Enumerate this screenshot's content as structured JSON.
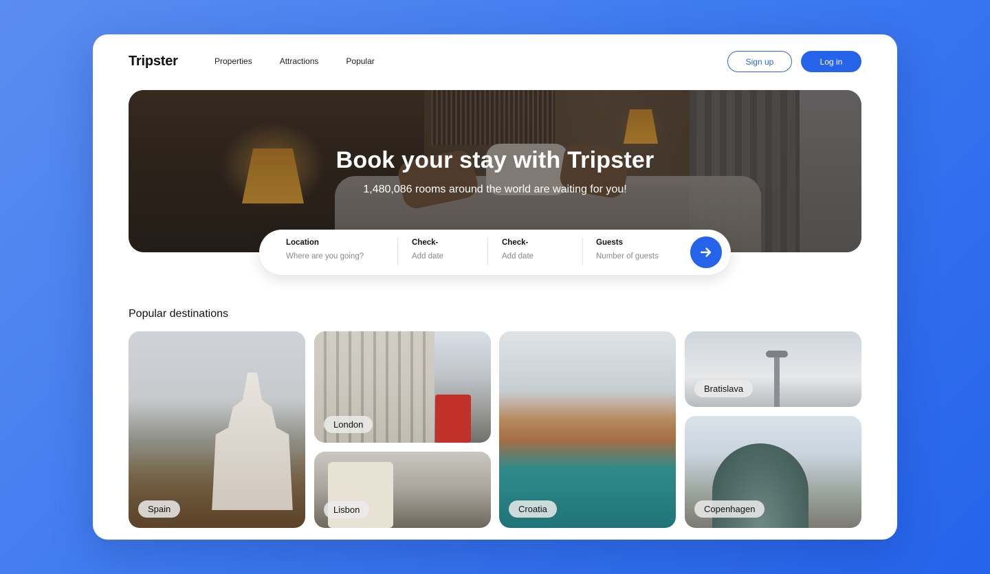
{
  "header": {
    "logo": "Tripster",
    "nav": [
      "Properties",
      "Attractions",
      "Popular"
    ],
    "signup_label": "Sign up",
    "login_label": "Log in"
  },
  "hero": {
    "title": "Book your stay with Tripster",
    "subtitle": "1,480,086 rooms around the world are waiting for you!"
  },
  "search": {
    "fields": [
      {
        "label": "Location",
        "placeholder": "Where are you going?"
      },
      {
        "label": "Check-",
        "placeholder": "Add date"
      },
      {
        "label": "Check-",
        "placeholder": "Add date"
      },
      {
        "label": "Guests",
        "placeholder": "Number of guests"
      }
    ],
    "submit_icon": "arrow-right-icon"
  },
  "destinations": {
    "title": "Popular destinations",
    "items": [
      "Spain",
      "London",
      "Lisbon",
      "Croatia",
      "Bratislava",
      "Copenhagen"
    ]
  },
  "colors": {
    "accent": "#2563eb",
    "background": "#3f7bf0"
  }
}
